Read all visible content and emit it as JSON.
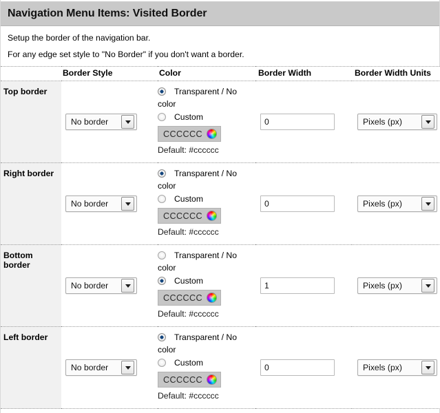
{
  "header": {
    "title": "Navigation Menu Items: Visited Border"
  },
  "intro": {
    "line1": "Setup the border of the navigation bar.",
    "line2": "For any edge set style to \"No Border\" if you don't want a border."
  },
  "table": {
    "columns": {
      "label": "",
      "border_style": "Border Style",
      "color": "Color",
      "border_width": "Border Width",
      "border_width_units": "Border Width Units"
    },
    "color_options": {
      "transparent_label": "Transparent / No",
      "transparent_label_wrap": "color",
      "custom_label": "Custom"
    },
    "rows": [
      {
        "label": "Top border",
        "style_value": "No border",
        "color_mode": "transparent",
        "color_value": "CCCCCC",
        "default_note": "Default: #cccccc",
        "width_value": "0",
        "units_value": "Pixels (px)"
      },
      {
        "label": "Right border",
        "style_value": "No border",
        "color_mode": "transparent",
        "color_value": "CCCCCC",
        "default_note": "Default: #cccccc",
        "width_value": "0",
        "units_value": "Pixels (px)"
      },
      {
        "label": "Bottom border",
        "style_value": "No border",
        "color_mode": "custom",
        "color_value": "CCCCCC",
        "default_note": "Default: #cccccc",
        "width_value": "1",
        "units_value": "Pixels (px)"
      },
      {
        "label": "Left border",
        "style_value": "No border",
        "color_mode": "transparent",
        "color_value": "CCCCCC",
        "default_note": "Default: #cccccc",
        "width_value": "0",
        "units_value": "Pixels (px)"
      }
    ]
  },
  "icons": {
    "color_wheel": "color-wheel-icon",
    "dropdown_arrow": "chevron-down-icon"
  },
  "colors": {
    "header_bar": "#c9c9c9",
    "label_column": "#f1f1f1",
    "swatch_background": "#c6c6c6",
    "radio_selected": "#14467e",
    "divider": "#9a9a9a"
  }
}
